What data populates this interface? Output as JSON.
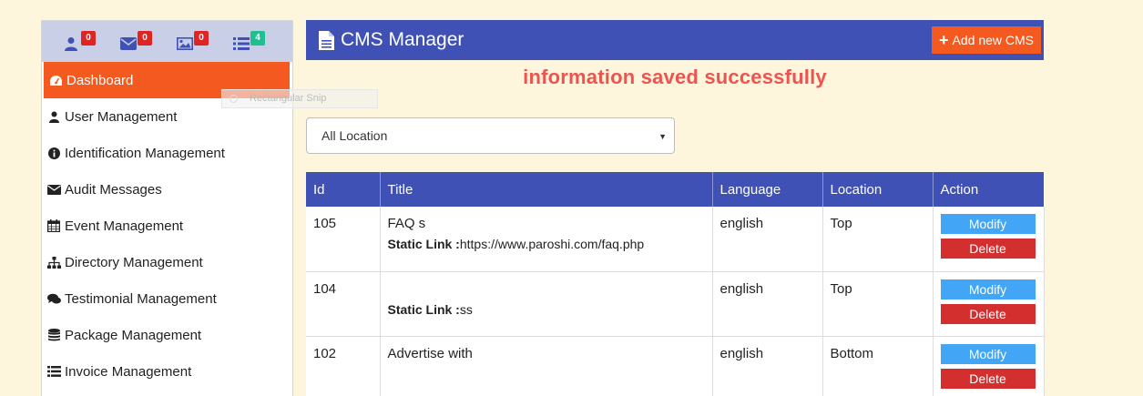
{
  "sidebar": {
    "badges": [
      {
        "icon": "user-icon",
        "count": "0",
        "color": "#e02424"
      },
      {
        "icon": "envelope-icon",
        "count": "0",
        "color": "#e02424"
      },
      {
        "icon": "image-icon",
        "count": "0",
        "color": "#e02424"
      },
      {
        "icon": "list-icon",
        "count": "4",
        "color": "#1fbf8f"
      }
    ],
    "items": [
      {
        "label": "Dashboard",
        "icon": "dashboard-icon",
        "active": true
      },
      {
        "label": "User Management",
        "icon": "user-icon"
      },
      {
        "label": "Identification Management",
        "icon": "info-circle-icon"
      },
      {
        "label": "Audit Messages",
        "icon": "envelope-icon"
      },
      {
        "label": "Event Management",
        "icon": "calendar-icon"
      },
      {
        "label": "Directory Management",
        "icon": "sitemap-icon"
      },
      {
        "label": "Testimonial Management",
        "icon": "comments-icon"
      },
      {
        "label": "Package Management",
        "icon": "database-icon"
      },
      {
        "label": "Invoice Management",
        "icon": "list-icon"
      }
    ]
  },
  "snip_overlay": {
    "label": "Rectangular Snip"
  },
  "header": {
    "title": "CMS Manager",
    "add_button": "Add new CMS"
  },
  "message": "information saved successfully",
  "location_filter": {
    "selected": "All Location"
  },
  "table": {
    "columns": [
      "Id",
      "Title",
      "Language",
      "Location",
      "Action"
    ],
    "static_link_label": "Static Link :",
    "rows": [
      {
        "id": "105",
        "title": "FAQ s",
        "static_link": "https://www.paroshi.com/faq.php",
        "language": "english",
        "location": "Top"
      },
      {
        "id": "104",
        "title": "",
        "static_link": "ss",
        "language": "english",
        "location": "Top"
      },
      {
        "id": "102",
        "title": "Advertise with",
        "static_link": "",
        "language": "english",
        "location": "Bottom"
      }
    ],
    "modify_label": "Modify",
    "delete_label": "Delete"
  },
  "colors": {
    "primary": "#3f51b5",
    "accent": "#f45a20",
    "success_text": "#ef5350",
    "modify": "#42a5f5",
    "delete": "#d32f2f",
    "page_bg": "#fdf6dc"
  }
}
